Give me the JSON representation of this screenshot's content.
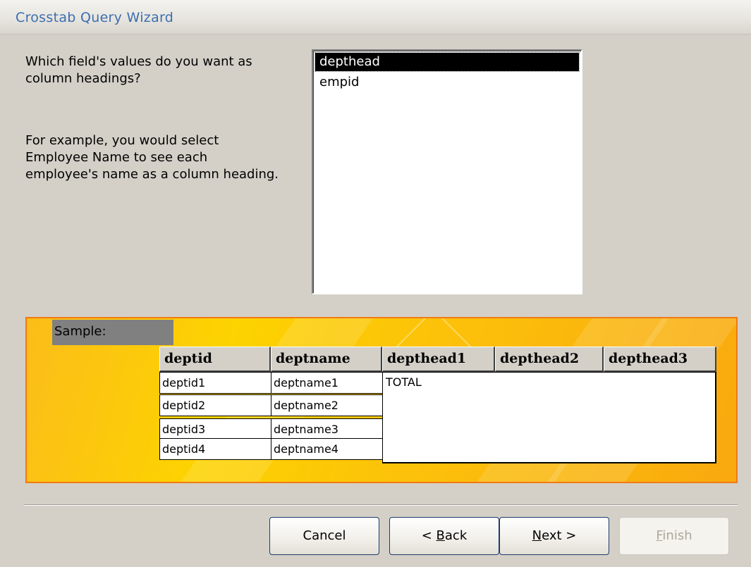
{
  "window": {
    "title": "Crosstab Query Wizard"
  },
  "prompt": {
    "line1": "Which field's values do you want as",
    "line2": "column headings?"
  },
  "example": {
    "line1": "For example, you would select",
    "line2": "Employee Name to see each",
    "line3": "employee's name as a column heading."
  },
  "fields": {
    "items": [
      {
        "label": "depthead",
        "selected": true
      },
      {
        "label": "empid",
        "selected": false
      }
    ]
  },
  "sample": {
    "label": "Sample:",
    "headers": [
      "deptid",
      "deptname",
      "depthead1",
      "depthead2",
      "depthead3"
    ],
    "rows": [
      [
        "deptid1",
        "deptname1"
      ],
      [
        "deptid2",
        "deptname2"
      ],
      [
        "deptid3",
        "deptname3"
      ],
      [
        "deptid4",
        "deptname4"
      ]
    ],
    "total_label": "TOTAL"
  },
  "buttons": {
    "cancel": "Cancel",
    "back_prefix": "< ",
    "back_hotkey": "B",
    "back_rest": "ack",
    "next_hotkey": "N",
    "next_rest": "ext >",
    "finish_hotkey": "F",
    "finish_rest": "inish"
  },
  "colors": {
    "title_text": "#3c6eb0",
    "dialog_bg": "#d4d0c8",
    "sample_bg": "#fdd300",
    "sample_border": "#f07a14",
    "selection_bg": "#000000"
  }
}
